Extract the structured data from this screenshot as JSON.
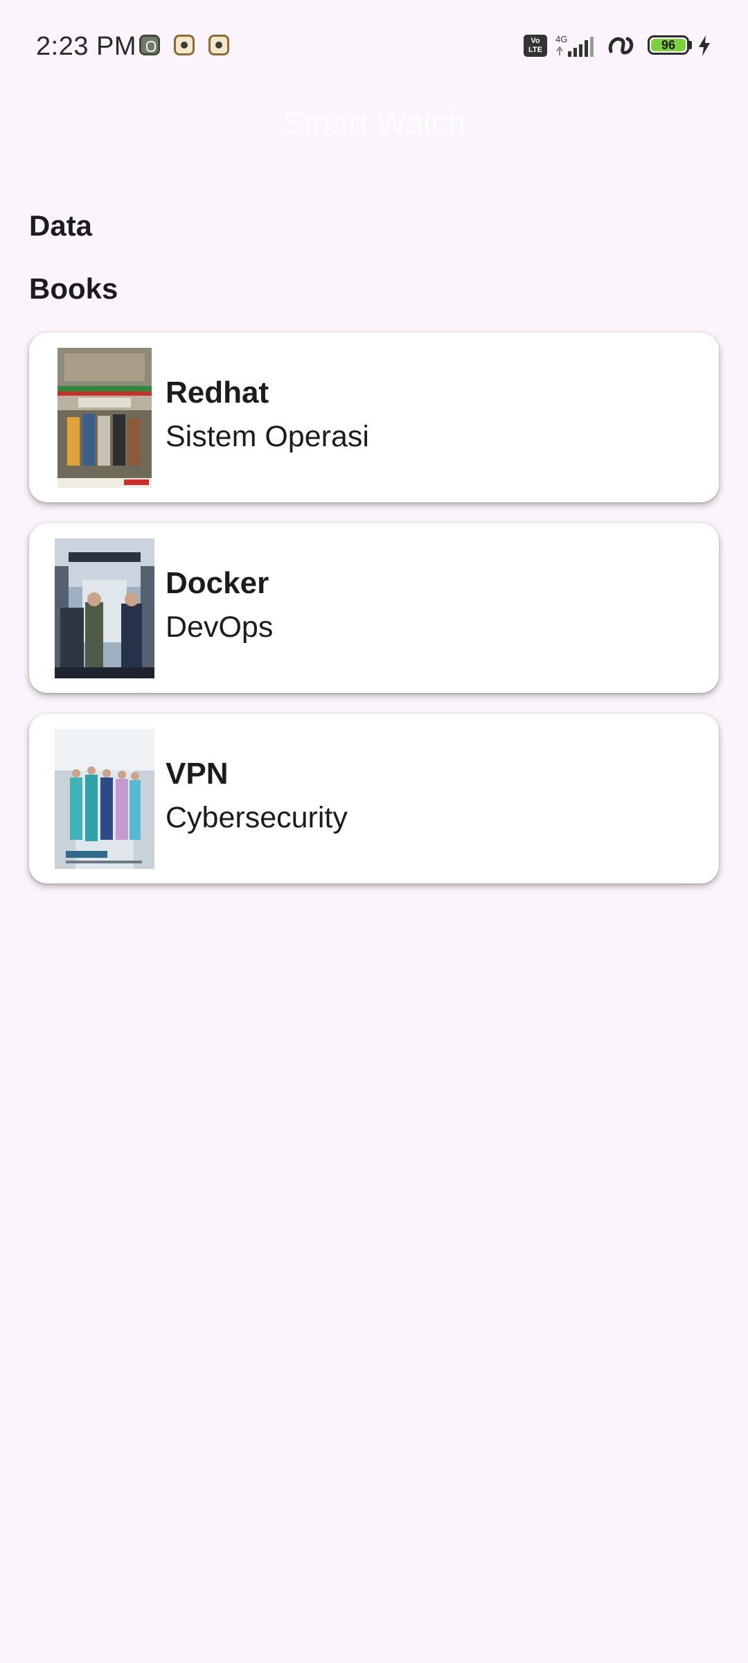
{
  "status_bar": {
    "time": "2:23 PM",
    "network": "4G",
    "volte": "Vo LTE",
    "battery": "96"
  },
  "app_bar": {
    "title": "Smart Watch"
  },
  "sections": {
    "data_heading": "Data",
    "books_heading": "Books"
  },
  "books": [
    {
      "title": "Redhat",
      "category": "Sistem Operasi"
    },
    {
      "title": "Docker",
      "category": "DevOps"
    },
    {
      "title": "VPN",
      "category": "Cybersecurity"
    }
  ]
}
